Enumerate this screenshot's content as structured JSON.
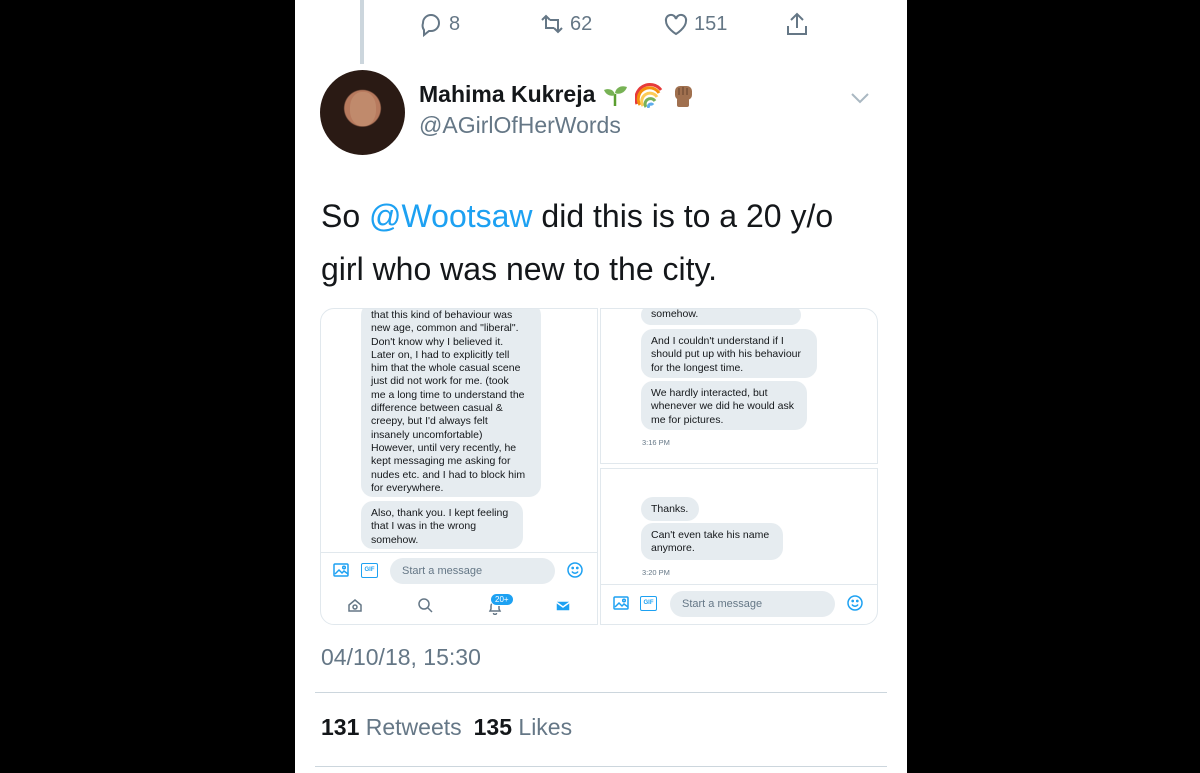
{
  "prev_tweet_actions": {
    "reply_count": "8",
    "retweet_count": "62",
    "like_count": "151"
  },
  "tweet": {
    "author_name": "Mahima Kukreja",
    "author_emojis": [
      "seedling",
      "rainbow",
      "raised-fist-medium-dark"
    ],
    "handle": "@AGirlOfHerWords",
    "text_prefix": "So ",
    "mention": "@Wootsaw",
    "text_suffix": " did this is to a 20 y/o girl who was new to the city.",
    "timestamp": "04/10/18, 15:30",
    "retweets_count": "131",
    "retweets_label": "Retweets",
    "likes_count": "135",
    "likes_label": "Likes"
  },
  "media": {
    "left_shot": {
      "bubble1_lines": [
        "that this kind of behaviour was",
        "new age, common and \"liberal\".",
        "Don't know why I believed it.",
        "Later on, I had to explicitly tell",
        "him that the whole casual scene",
        "just did not work for me. (took",
        "me a long time to understand the",
        "difference between casual &",
        "creepy, but I'd always felt",
        "insanely uncomfortable)",
        "However, until very recently, he",
        "kept messaging me asking for",
        "nudes etc. and I had to block him",
        "for everywhere."
      ],
      "bubble2_lines": [
        "Also, thank you. I kept feeling",
        "that I was in the wrong",
        "somehow."
      ],
      "composer_placeholder": "Start a message",
      "notification_badge": "20+"
    },
    "right_top_shot": {
      "bubble1": "somehow.",
      "bubble2_lines": [
        "And I couldn't understand if I",
        "should put up with his behaviour",
        "for the longest time."
      ],
      "bubble3_lines": [
        "We hardly interacted, but",
        "whenever we did he would ask",
        "me for pictures."
      ],
      "time": "3:16 PM"
    },
    "right_bottom_shot": {
      "bubble1": "Thanks.",
      "bubble2_lines": [
        "Can't even take his name",
        "anymore."
      ],
      "time": "3:20 PM",
      "composer_placeholder": "Start a message"
    }
  },
  "colors": {
    "link": "#1da1f2",
    "secondary_text": "#657786",
    "bubble": "#e6ecf0"
  }
}
